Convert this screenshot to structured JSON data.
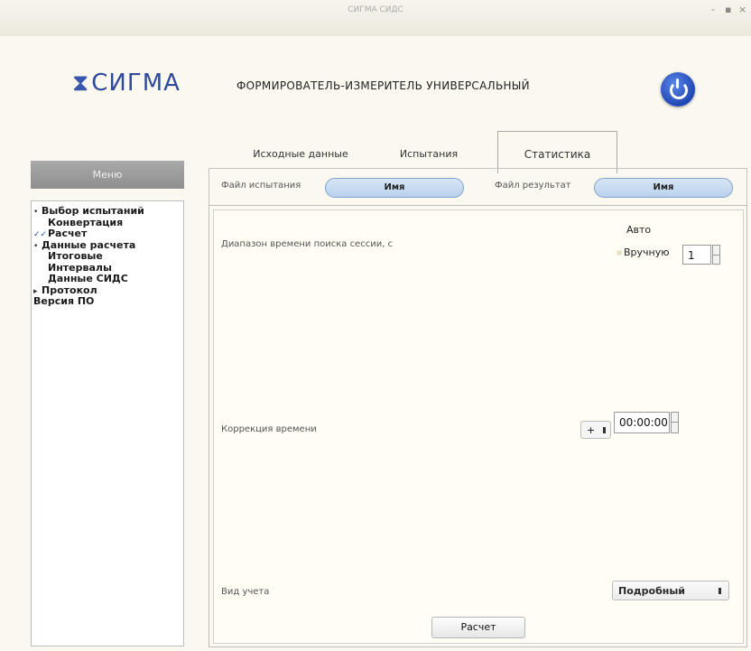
{
  "window": {
    "title": "СИГМА СИДС",
    "minimize": "-",
    "maximize": "▪",
    "close": "×"
  },
  "header": {
    "logo_text": "СИГМА",
    "app_title": "ФОРМИРОВАТЕЛЬ-ИЗМЕРИТЕЛЬ УНИВЕРСАЛЬНЫЙ"
  },
  "tabs": [
    {
      "label": "Исходные данные",
      "active": false
    },
    {
      "label": "Испытания",
      "active": false
    },
    {
      "label": "Статистика",
      "active": true
    }
  ],
  "sidebar": {
    "header": "Меню",
    "items": [
      {
        "marker": "•",
        "label": "Выбор испытаний"
      },
      {
        "marker": "",
        "label": "Конвертация"
      },
      {
        "marker": "✓✓",
        "label": "Расчет"
      },
      {
        "marker": "•",
        "label": "Данные расчета"
      },
      {
        "marker": "",
        "label": "Итоговые"
      },
      {
        "marker": "",
        "label": "Интервалы"
      },
      {
        "marker": "",
        "label": "Данные СИДС"
      },
      {
        "marker": "▸",
        "label": "Протокол"
      },
      {
        "marker": "",
        "label": "Версия ПО"
      }
    ]
  },
  "files": {
    "test_label": "Файл испытания",
    "test_value": "Имя",
    "result_label": "Файл результат",
    "result_value": "Имя"
  },
  "session": {
    "label": "Диапазон времени поиска сессии, с",
    "auto_label": "Авто",
    "manual_label": "Вручную",
    "manual_value": "1"
  },
  "correction": {
    "label": "Коррекция времени",
    "sign": "+",
    "value": "00:00:00"
  },
  "accounting": {
    "label": "Вид учета",
    "value": "Подробный"
  },
  "actions": {
    "calculate": "Расчет"
  }
}
